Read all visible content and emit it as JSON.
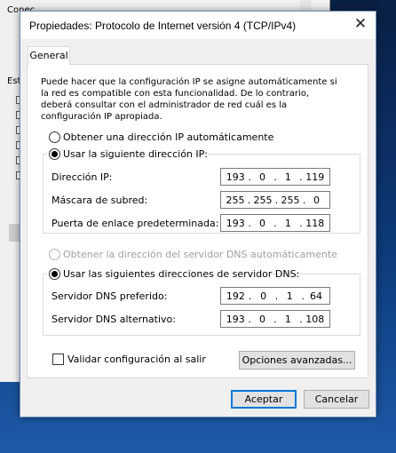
{
  "background_window": {
    "texts": [
      "Conec",
      "Est"
    ],
    "checkbox_count": 6
  },
  "dialog": {
    "title": "Propiedades: Protocolo de Internet versión 4 (TCP/IPv4)",
    "close_glyph": "✕",
    "tab_general": "General",
    "intro": "Puede hacer que la configuración IP se asigne automáticamente si la red es compatible con esta funcionalidad. De lo contrario, deberá consultar con el administrador de red cuál es la configuración IP apropiada.",
    "ip_auto_label": "Obtener una dirección IP automáticamente",
    "ip_manual_label": "Usar la siguiente dirección IP:",
    "ip_mode": "manual",
    "fields": {
      "ip_label": "Dirección IP:",
      "ip_value": [
        "193",
        "0",
        "1",
        "119"
      ],
      "mask_label": "Máscara de subred:",
      "mask_value": [
        "255",
        "255",
        "255",
        "0"
      ],
      "gateway_label": "Puerta de enlace predeterminada:",
      "gateway_value": [
        "193",
        "0",
        "1",
        "118"
      ]
    },
    "dns_auto_label": "Obtener la dirección del servidor DNS automáticamente",
    "dns_manual_label": "Usar las siguientes direcciones de servidor DNS:",
    "dns_mode": "manual",
    "dns": {
      "preferred_label": "Servidor DNS preferido:",
      "preferred_value": [
        "192",
        "0",
        "1",
        "64"
      ],
      "alternate_label": "Servidor DNS alternativo:",
      "alternate_value": [
        "193",
        "0",
        "1",
        "108"
      ]
    },
    "validate_label": "Validar configuración al salir",
    "validate_checked": false,
    "advanced_button": "Opciones avanzadas...",
    "ok_button": "Aceptar",
    "cancel_button": "Cancelar"
  }
}
